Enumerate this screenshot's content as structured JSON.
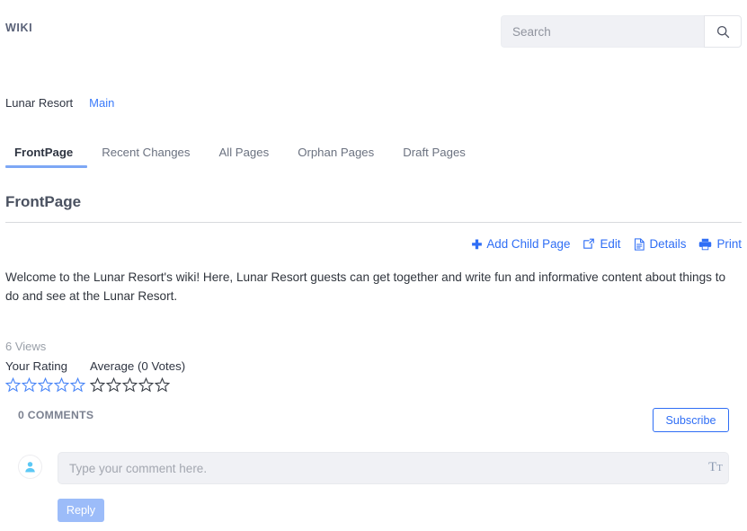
{
  "header": {
    "brand": "WIKI",
    "search": {
      "value": "",
      "placeholder": "Search",
      "button_icon": "search-icon"
    }
  },
  "breadcrumb": {
    "root": "Lunar Resort",
    "current": "Main"
  },
  "tabs": [
    {
      "label": "FrontPage",
      "active": true
    },
    {
      "label": "Recent Changes",
      "active": false
    },
    {
      "label": "All Pages",
      "active": false
    },
    {
      "label": "Orphan Pages",
      "active": false
    },
    {
      "label": "Draft Pages",
      "active": false
    }
  ],
  "page": {
    "title": "FrontPage",
    "body": "Welcome to the Lunar Resort's wiki! Here, Lunar Resort guests can get together and write fun and informative content about things to do and see at the Lunar Resort."
  },
  "actions": [
    {
      "label": "Add Child Page",
      "icon": "plus-icon"
    },
    {
      "label": "Edit",
      "icon": "pencil-square-icon"
    },
    {
      "label": "Details",
      "icon": "document-icon"
    },
    {
      "label": "Print",
      "icon": "printer-icon"
    }
  ],
  "stats": {
    "views": "6 Views",
    "your_rating_label": "Your Rating",
    "average_label": "Average (0 Votes)",
    "your_rating_value": 0,
    "average_rating_value": 0,
    "star_count": 5
  },
  "comments": {
    "count_label": "0 COMMENTS",
    "subscribe_label": "Subscribe",
    "input_value": "",
    "input_placeholder": "Type your comment here.",
    "format_icon": "text-format-icon",
    "avatar_icon": "user-icon",
    "reply_label": "Reply"
  },
  "colors": {
    "link": "#2f6ef5",
    "brand_text": "#596177",
    "tab_active_underline": "#7da7f5",
    "star_active": "#4a86f7",
    "star_inactive": "#3a3f47",
    "reply_disabled": "#9cbcf9",
    "input_bg": "#f0f1f5"
  }
}
